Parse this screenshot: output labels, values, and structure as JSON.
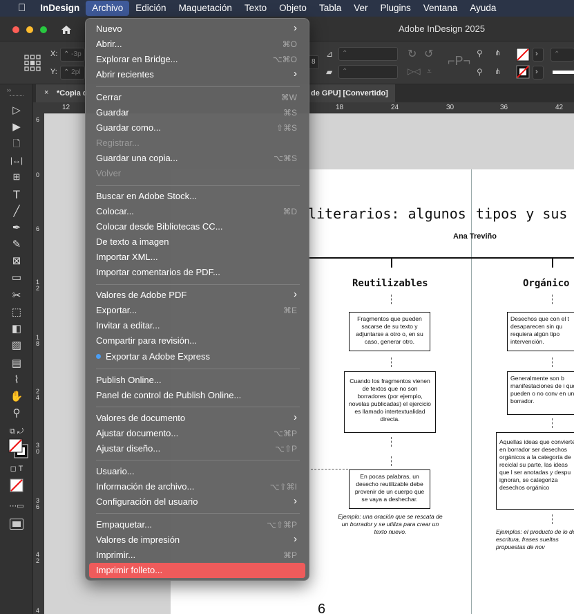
{
  "menubar": {
    "items": [
      "InDesign",
      "Archivo",
      "Edición",
      "Maquetación",
      "Texto",
      "Objeto",
      "Tabla",
      "Ver",
      "Plugins",
      "Ventana",
      "Ayuda"
    ],
    "active": "Archivo"
  },
  "window": {
    "title": "Adobe InDesign 2025"
  },
  "control": {
    "x_label": "X:",
    "y_label": "Y:",
    "x_value": "-3p",
    "y_value": "2pl"
  },
  "doc_tab": {
    "close": "×",
    "name_start": "*Copia d",
    "name_end": "de GPU] [Convertido]"
  },
  "ruler_top": [
    "12",
    "18",
    "24",
    "30",
    "36",
    "42"
  ],
  "ruler_left": [
    "6",
    "0",
    "6",
    "1 2",
    "1 8",
    "2 4",
    "3 0",
    "3 6",
    "4 2",
    "4"
  ],
  "document": {
    "title_left": "literarios: algunos",
    "title_right": "tipos y sus t",
    "author": "Ana Treviño",
    "col1": {
      "head": "Reutilizables",
      "box1": "Fragmentos que pueden sacarse de su texto y adjuntarse a otro o, en su caso, generar otro.",
      "box2": "Cuando los fragmentos vienen de textos que no son borradores (por ejemplo, novelas publicadas) el ejercicio es llamado intertextualidad directa.",
      "box3": "En pocas palabras, un desecho reutilizable debe provenir de un cuerpo que se vaya a deshechar.",
      "example": "Ejemplo: una oración que se rescata de un borrador y se utiliza para crear un texto  nuevo."
    },
    "col2": {
      "head": "Orgánico",
      "box1": "Desechos que con el t desaparecen sin qu requiera algún tipo intervención.",
      "box2": "Generalmente son b manifestaciones de i que pueden o no conv en un borrador.",
      "box3": "Aquellas ideas que convierten en borrador ser desechos orgánicos a la categoría de reciclal su parte, las ideas que l ser anotadas y despu ignoran, se categoriza desechos orgánico",
      "example": "Ejemplos: el producto de lo de escritura, frases sueltas propuestas de nov"
    },
    "page_number": "6"
  },
  "file_menu": {
    "items": [
      {
        "label": "Nuevo",
        "shortcut": "",
        "submenu": true,
        "disabled": false
      },
      {
        "label": "Abrir...",
        "shortcut": "⌘O",
        "submenu": false,
        "disabled": false
      },
      {
        "label": "Explorar en Bridge...",
        "shortcut": "⌥⌘O",
        "submenu": false,
        "disabled": false
      },
      {
        "label": "Abrir recientes",
        "shortcut": "",
        "submenu": true,
        "disabled": false
      },
      {
        "label": "Cerrar",
        "shortcut": "⌘W",
        "submenu": false,
        "disabled": false
      },
      {
        "label": "Guardar",
        "shortcut": "⌘S",
        "submenu": false,
        "disabled": false
      },
      {
        "label": "Guardar como...",
        "shortcut": "⇧⌘S",
        "submenu": false,
        "disabled": false
      },
      {
        "label": "Registrar...",
        "shortcut": "",
        "submenu": false,
        "disabled": true
      },
      {
        "label": "Guardar una copia...",
        "shortcut": "⌥⌘S",
        "submenu": false,
        "disabled": false
      },
      {
        "label": "Volver",
        "shortcut": "",
        "submenu": false,
        "disabled": true
      },
      {
        "label": "Buscar en Adobe Stock...",
        "shortcut": "",
        "submenu": false,
        "disabled": false
      },
      {
        "label": "Colocar...",
        "shortcut": "⌘D",
        "submenu": false,
        "disabled": false
      },
      {
        "label": "Colocar desde Bibliotecas CC...",
        "shortcut": "",
        "submenu": false,
        "disabled": false
      },
      {
        "label": "De texto a imagen",
        "shortcut": "",
        "submenu": false,
        "disabled": false
      },
      {
        "label": "Importar XML...",
        "shortcut": "",
        "submenu": false,
        "disabled": false
      },
      {
        "label": "Importar comentarios de PDF...",
        "shortcut": "",
        "submenu": false,
        "disabled": false
      },
      {
        "label": "Valores de Adobe PDF",
        "shortcut": "",
        "submenu": true,
        "disabled": false
      },
      {
        "label": "Exportar...",
        "shortcut": "⌘E",
        "submenu": false,
        "disabled": false
      },
      {
        "label": "Invitar a editar...",
        "shortcut": "",
        "submenu": false,
        "disabled": false
      },
      {
        "label": "Compartir para revisión...",
        "shortcut": "",
        "submenu": false,
        "disabled": false
      },
      {
        "label": "Exportar a Adobe Express",
        "shortcut": "",
        "submenu": false,
        "disabled": false
      },
      {
        "label": "Publish Online...",
        "shortcut": "",
        "submenu": false,
        "disabled": false
      },
      {
        "label": "Panel de control de Publish Online...",
        "shortcut": "",
        "submenu": false,
        "disabled": false
      },
      {
        "label": "Valores de documento",
        "shortcut": "",
        "submenu": true,
        "disabled": false
      },
      {
        "label": "Ajustar documento...",
        "shortcut": "⌥⌘P",
        "submenu": false,
        "disabled": false
      },
      {
        "label": "Ajustar diseño...",
        "shortcut": "⌥⇧P",
        "submenu": false,
        "disabled": false
      },
      {
        "label": "Usuario...",
        "shortcut": "",
        "submenu": false,
        "disabled": false
      },
      {
        "label": "Información de archivo...",
        "shortcut": "⌥⇧⌘I",
        "submenu": false,
        "disabled": false
      },
      {
        "label": "Configuración del usuario",
        "shortcut": "",
        "submenu": true,
        "disabled": false
      },
      {
        "label": "Empaquetar...",
        "shortcut": "⌥⇧⌘P",
        "submenu": false,
        "disabled": false
      },
      {
        "label": "Valores de impresión",
        "shortcut": "",
        "submenu": true,
        "disabled": false
      },
      {
        "label": "Imprimir...",
        "shortcut": "⌘P",
        "submenu": false,
        "disabled": false
      },
      {
        "label": "Imprimir folleto...",
        "shortcut": "",
        "submenu": false,
        "disabled": false
      }
    ],
    "highlighted": "Imprimir folleto..."
  },
  "colors": {
    "accent_highlight": "#ef5b5b",
    "menubar_bg": "#2b3447",
    "express_dot": "#4a9ef5"
  }
}
